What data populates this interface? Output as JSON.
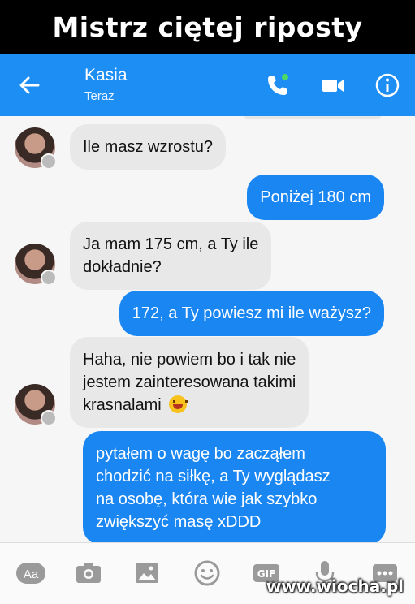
{
  "meme": {
    "title": "Mistrz ciętej riposty",
    "watermark": "www.wiocha.pl"
  },
  "header": {
    "contact_name": "Kasia",
    "status": "Teraz",
    "accent_color": "#1d8ef4",
    "icons": [
      "back-arrow-icon",
      "phone-icon",
      "video-camera-icon",
      "info-icon"
    ]
  },
  "messages": [
    {
      "from": "them",
      "text": "Ile masz wzrostu?"
    },
    {
      "from": "me",
      "text": "Poniżej 180 cm"
    },
    {
      "from": "them",
      "line1": "Ja mam 175 cm, a Ty ile",
      "line2": "dokładnie?"
    },
    {
      "from": "me",
      "text": "172, a Ty powiesz mi ile ważysz?"
    },
    {
      "from": "them",
      "line1": "Haha, nie powiem bo i tak nie",
      "line2": "jestem zainteresowana takimi",
      "line3": "krasnalami",
      "emoji": "grinning-face-emoji"
    },
    {
      "from": "me",
      "line1": "pytałem o wagę bo zacząłem",
      "line2": "chodzić na siłkę, a Ty wyglądasz",
      "line3": "na osobę, która wie jak szybko",
      "line4": "zwiększyć masę xDDD"
    }
  ],
  "toolbar": {
    "aa_label": "Aa",
    "gif_label": "GIF",
    "icons": [
      "text-format-icon",
      "camera-icon",
      "gallery-icon",
      "emoji-icon",
      "gif-icon",
      "microphone-icon",
      "more-icon"
    ]
  }
}
